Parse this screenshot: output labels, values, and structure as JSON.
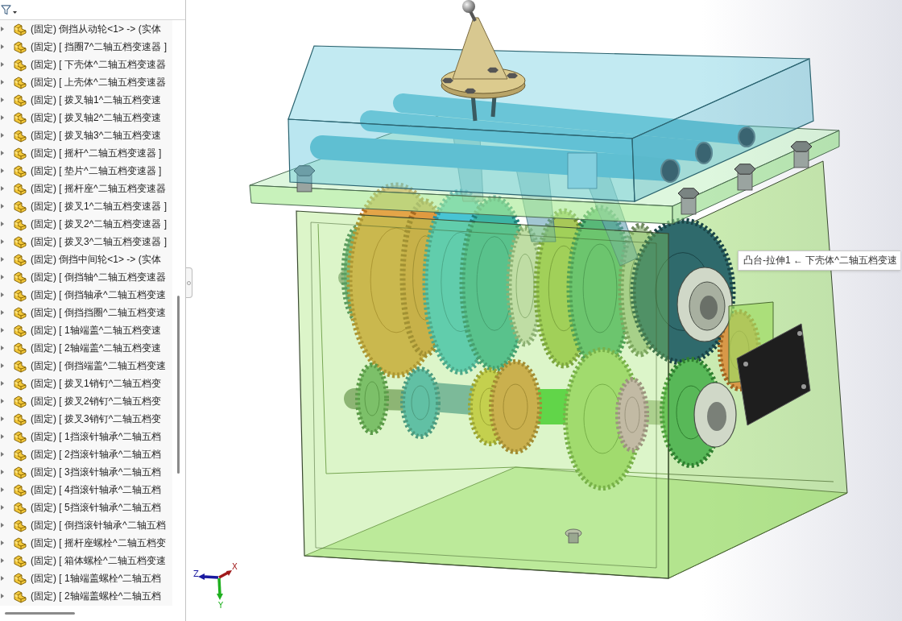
{
  "tree": {
    "items": [
      {
        "label": "(固定) 倒挡从动轮<1> -> (实体",
        "expanded": false
      },
      {
        "label": "(固定) [ 挡圈7^二轴五档变速器 ]",
        "expanded": false
      },
      {
        "label": "(固定) [ 下壳体^二轴五档变速器",
        "expanded": false
      },
      {
        "label": "(固定) [ 上壳体^二轴五档变速器",
        "expanded": false
      },
      {
        "label": "(固定) [ 拨叉轴1^二轴五档变速",
        "expanded": false
      },
      {
        "label": "(固定) [ 拨叉轴2^二轴五档变速",
        "expanded": false
      },
      {
        "label": "(固定) [ 拨叉轴3^二轴五档变速",
        "expanded": false
      },
      {
        "label": "(固定) [ 摇杆^二轴五档变速器 ]",
        "expanded": false
      },
      {
        "label": "(固定) [ 垫片^二轴五档变速器 ]",
        "expanded": false
      },
      {
        "label": "(固定) [ 摇杆座^二轴五档变速器",
        "expanded": false
      },
      {
        "label": "(固定) [ 拨叉1^二轴五档变速器 ]",
        "expanded": false
      },
      {
        "label": "(固定) [ 拨叉2^二轴五档变速器 ]",
        "expanded": false
      },
      {
        "label": "(固定) [ 拨叉3^二轴五档变速器 ]",
        "expanded": false
      },
      {
        "label": "(固定) 倒挡中间轮<1> -> (实体",
        "expanded": false
      },
      {
        "label": "(固定) [ 倒挡轴^二轴五档变速器",
        "expanded": false
      },
      {
        "label": "(固定) [ 倒挡轴承^二轴五档变速",
        "expanded": false
      },
      {
        "label": "(固定) [ 倒挡挡圈^二轴五档变速",
        "expanded": false
      },
      {
        "label": "(固定) [ 1轴端盖^二轴五档变速",
        "expanded": false
      },
      {
        "label": "(固定) [ 2轴端盖^二轴五档变速",
        "expanded": false
      },
      {
        "label": "(固定) [ 倒挡端盖^二轴五档变速",
        "expanded": false
      },
      {
        "label": "(固定) [ 拨叉1销钉^二轴五档变",
        "expanded": false
      },
      {
        "label": "(固定) [ 拨叉2销钉^二轴五档变",
        "expanded": false
      },
      {
        "label": "(固定) [ 拨叉3销钉^二轴五档变",
        "expanded": false
      },
      {
        "label": "(固定) [ 1挡滚针轴承^二轴五档",
        "expanded": false
      },
      {
        "label": "(固定) [ 2挡滚针轴承^二轴五档",
        "expanded": false
      },
      {
        "label": "(固定) [ 3挡滚针轴承^二轴五档",
        "expanded": false
      },
      {
        "label": "(固定) [ 4挡滚针轴承^二轴五档",
        "expanded": false
      },
      {
        "label": "(固定) [ 5挡滚针轴承^二轴五档",
        "expanded": false
      },
      {
        "label": "(固定) [ 倒挡滚针轴承^二轴五档",
        "expanded": false
      },
      {
        "label": "(固定) [ 摇杆座螺栓^二轴五档变",
        "expanded": false
      },
      {
        "label": "(固定) [ 箱体螺栓^二轴五档变速",
        "expanded": false
      },
      {
        "label": "(固定) [ 1轴端盖螺栓^二轴五档",
        "expanded": false
      },
      {
        "label": "(固定) [ 2轴端盖螺栓^二轴五档",
        "expanded": false
      }
    ]
  },
  "viewport": {
    "tooltip": "凸台-拉伸1 ← 下壳体^二轴五档变速",
    "triad": {
      "x_label": "X",
      "y_label": "Y",
      "z_label": "Z"
    }
  }
}
